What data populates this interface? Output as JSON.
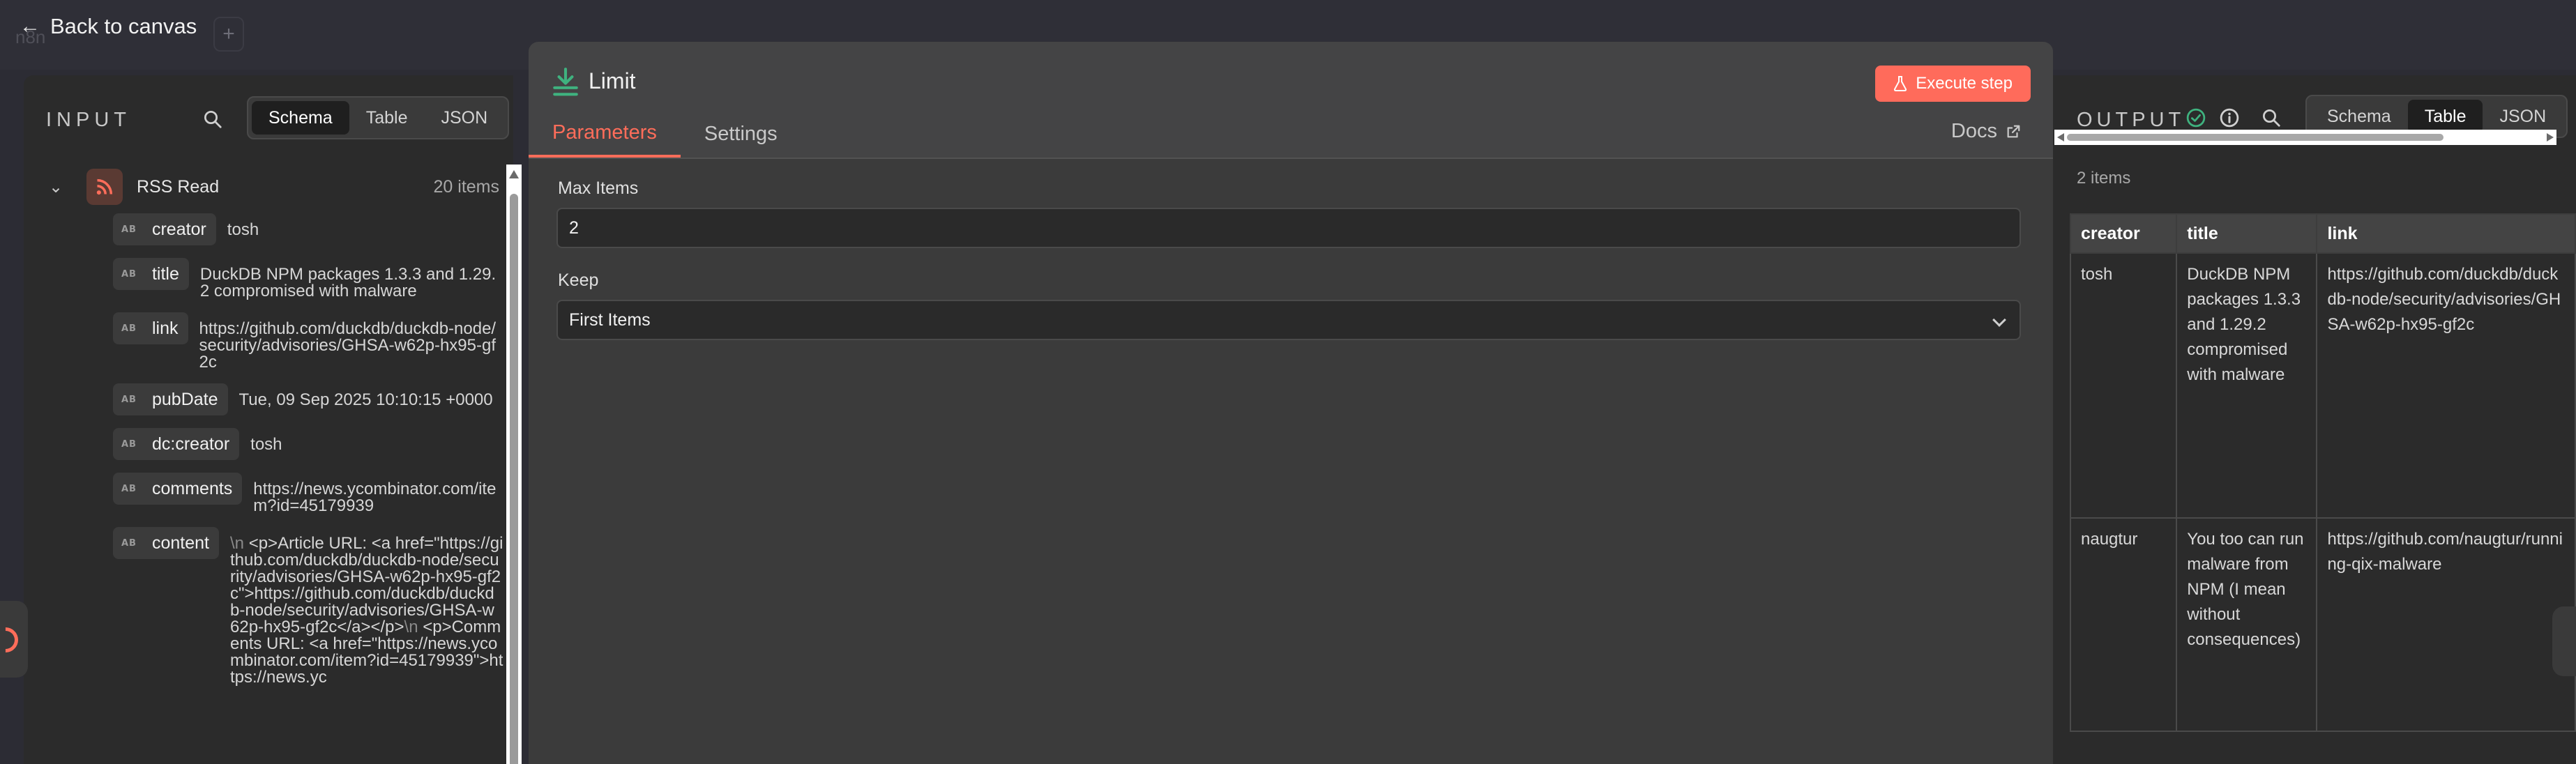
{
  "topbar": {
    "back_label": "Back to canvas",
    "ghost_logo": "n8n",
    "add_tab": "+"
  },
  "input": {
    "title": "INPUT",
    "views": [
      "Schema",
      "Table",
      "JSON"
    ],
    "active_view": "Schema",
    "node": {
      "name": "RSS Read",
      "count": "20 items",
      "icon": "rss-icon"
    },
    "type_badge": "AB",
    "fields": [
      {
        "key": "creator",
        "value": "tosh"
      },
      {
        "key": "title",
        "value": "DuckDB NPM packages 1.3.3 and 1.29.2 compromised with malware"
      },
      {
        "key": "link",
        "value": "https://github.com/duckdb/duckdb-node/security/advisories/GHSA-w62p-hx95-gf2c"
      },
      {
        "key": "pubDate",
        "value": "Tue, 09 Sep 2025 10:10:15 +0000"
      },
      {
        "key": "dc:creator",
        "value": "tosh"
      },
      {
        "key": "comments",
        "value": "https://news.ycombinator.com/item?id=45179939"
      },
      {
        "key": "content",
        "value": "<p>Article URL: <a href=\"https://github.com/duckdb/duckdb-node/security/advisories/GHSA-w62p-hx95-gf2c\">https://github.com/duckdb/duckdb-node/security/advisories/GHSA-w62p-hx95-gf2c</a></p>",
        "value_tail": "<p>Comments URL: <a href=\"https://news.ycombinator.com/item?id=45179939\">https://news.yc"
      }
    ],
    "newline_marker": "\\n"
  },
  "modal": {
    "node_title": "Limit",
    "execute_label": "Execute step",
    "tabs": [
      "Parameters",
      "Settings"
    ],
    "active_tab": "Parameters",
    "docs_label": "Docs",
    "params": [
      {
        "label": "Max Items",
        "value": "2"
      },
      {
        "label": "Keep",
        "value": "First Items"
      }
    ]
  },
  "output": {
    "title": "OUTPUT",
    "views": [
      "Schema",
      "Table",
      "JSON"
    ],
    "active_view": "Table",
    "count": "2 items",
    "columns": [
      "creator",
      "title",
      "link"
    ],
    "rows": [
      [
        "tosh",
        "DuckDB NPM packages 1.3.3 and 1.29.2 compromised with malware",
        "https://github.com/duckdb/duckdb-node/security/advisories/GHSA-w62p-hx95-gf2c"
      ],
      [
        "naugtur",
        "You too can run malware from NPM (I mean without consequences)",
        "https://github.com/naugtur/running-qix-malware"
      ]
    ]
  },
  "colors": {
    "accent": "#ff6d5a",
    "execute_button": "#ff6b5b",
    "success": "#3fb27f",
    "rss_brand": "#ff6d5a",
    "limit_icon": "#3fb27f"
  }
}
